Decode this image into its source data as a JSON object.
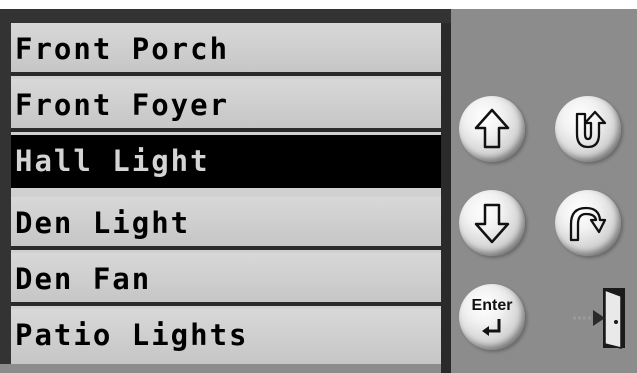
{
  "list": {
    "items": [
      {
        "label": "Front Porch",
        "selected": false
      },
      {
        "label": "Front Foyer",
        "selected": false
      },
      {
        "label": "Hall Light",
        "selected": true
      },
      {
        "label": "Den Light",
        "selected": false
      },
      {
        "label": "Den Fan",
        "selected": false
      },
      {
        "label": "Patio Lights",
        "selected": false
      }
    ]
  },
  "controls": {
    "up_icon": "arrow-up-icon",
    "down_icon": "arrow-down-icon",
    "undo_icon": "u-turn-icon",
    "redo_icon": "arch-arrow-icon",
    "enter_label": "Enter",
    "exit_icon": "exit-door-icon"
  },
  "colors": {
    "selected_bg": "#000000",
    "selected_text": "#d4d4d4",
    "item_bg": "#d0d0d0",
    "panel_bg": "#8c8c8c"
  }
}
